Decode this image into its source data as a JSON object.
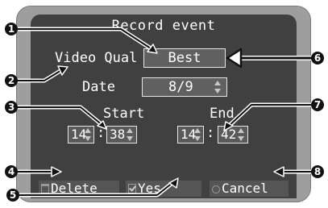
{
  "dialog": {
    "title": "Record event",
    "video_quality": {
      "label": "Video Qual",
      "value": "Best"
    },
    "date": {
      "label": "Date",
      "value": "8/9"
    },
    "start": {
      "label": "Start",
      "hour": "14",
      "minute": "38"
    },
    "end": {
      "label": "End",
      "hour": "14",
      "minute": "42"
    },
    "separator": ":",
    "buttons": {
      "delete": "Delete",
      "yes": "Yes",
      "cancel": "Cancel"
    }
  },
  "callouts": [
    "1",
    "2",
    "3",
    "4",
    "5",
    "6",
    "7",
    "8"
  ]
}
